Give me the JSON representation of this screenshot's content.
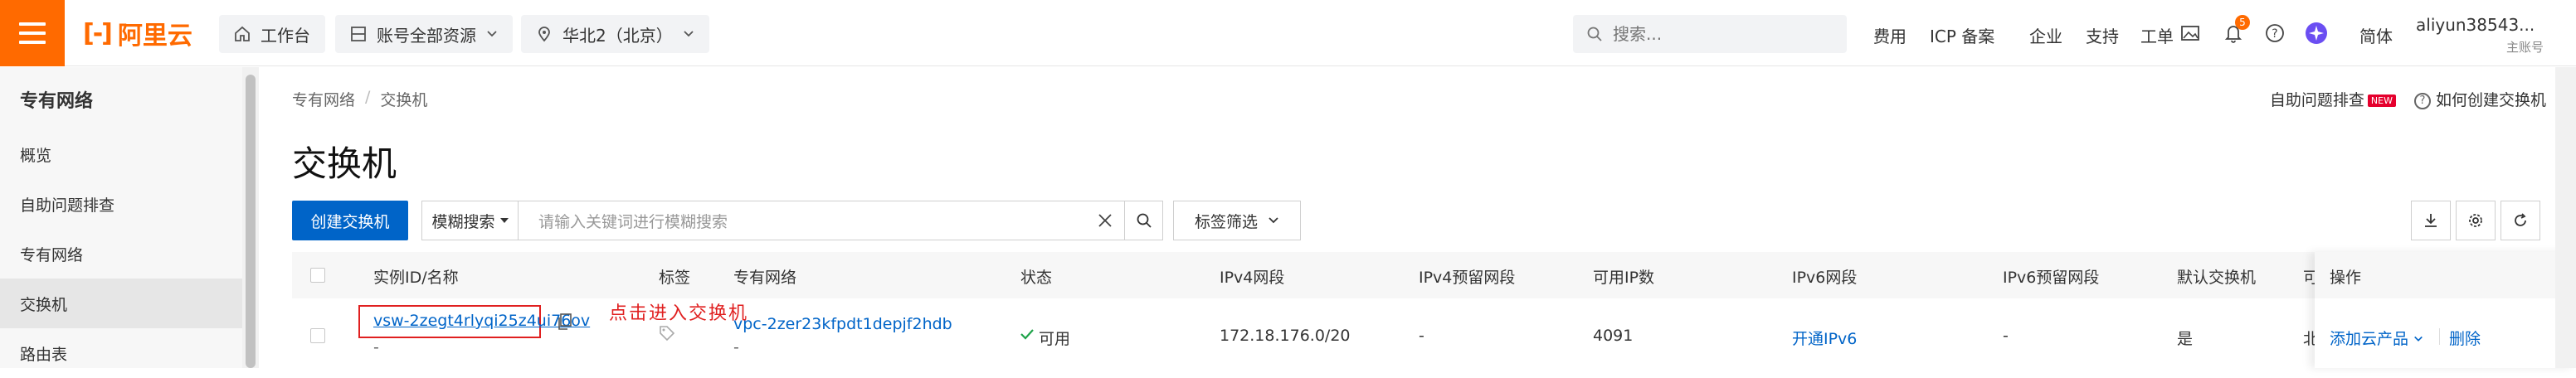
{
  "topbar": {
    "brand": "阿里云",
    "workbench": "工作台",
    "resource_scope": "账号全部资源",
    "region": "华北2（北京）",
    "search_placeholder": "搜索...",
    "nav": [
      "费用",
      "ICP 备案",
      "企业",
      "支持",
      "工单"
    ],
    "notification_count": "5",
    "language": "简体",
    "user_name": "aliyun38543...",
    "user_role": "主账号",
    "brand_color": "#ff6a00"
  },
  "sidebar": {
    "title": "专有网络",
    "items": [
      {
        "label": "概览"
      },
      {
        "label": "自助问题排查"
      },
      {
        "label": "专有网络"
      },
      {
        "label": "交换机"
      },
      {
        "label": "路由表"
      }
    ],
    "active_index": 3
  },
  "main": {
    "breadcrumb": [
      "专有网络",
      "交换机"
    ],
    "title": "交换机",
    "help_troubleshoot": "自助问题排查",
    "help_new_tag": "NEW",
    "help_howto": "如何创建交换机",
    "create_button": "创建交换机",
    "filter_type": "模糊搜索",
    "filter_placeholder": "请输入关键词进行模糊搜索",
    "tag_filter": "标签筛选",
    "primary_color": "#0064c8"
  },
  "table": {
    "headers": [
      "实例ID/名称",
      "标签",
      "专有网络",
      "状态",
      "IPv4网段",
      "IPv4预留网段",
      "可用IP数",
      "IPv6网段",
      "IPv6预留网段",
      "默认交换机",
      "可",
      "操作"
    ],
    "row": {
      "id": "vsw-2zegt4rlyqi25z4ui76ov",
      "name": "-",
      "vpc_id": "vpc-2zer23kfpdt1depjf2hdb",
      "vpc_name": "-",
      "status": "可用",
      "ipv4": "172.18.176.0/20",
      "ipv4_reserved": "-",
      "available_ips": "4091",
      "ipv6": "开通IPv6",
      "ipv6_reserved": "-",
      "default": "是",
      "zone_partial": "北",
      "action_add": "添加云产品",
      "action_delete": "删除"
    },
    "annotation": "点击进入交换机"
  }
}
